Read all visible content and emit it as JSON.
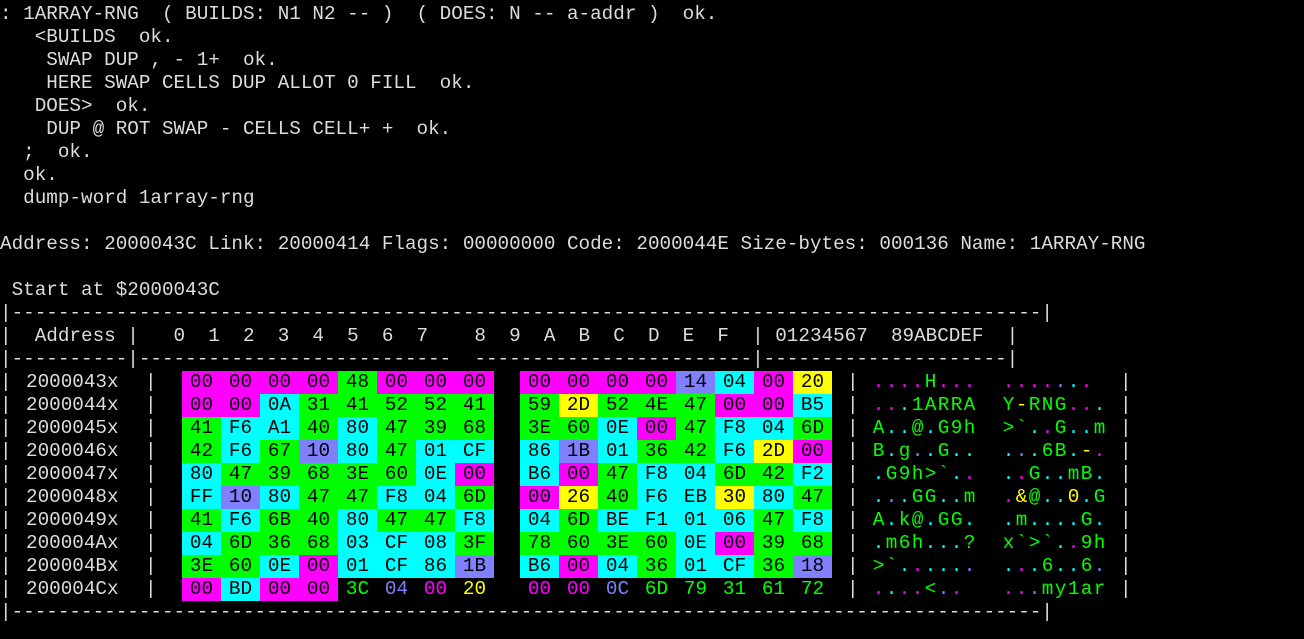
{
  "terminal": {
    "lines": [
      ": 1ARRAY-RNG  ( BUILDS: N1 N2 -- )  ( DOES: N -- a-addr )  ok.",
      "   <BUILDS  ok.",
      "    SWAP DUP , - 1+  ok.",
      "    HERE SWAP CELLS DUP ALLOT 0 FILL  ok.",
      "   DOES>  ok.",
      "    DUP @ ROT SWAP - CELLS CELL+ +  ok.",
      "  ;  ok.",
      "  ok.",
      "  dump-word 1array-rng",
      "",
      "Address: 2000043C Link: 20000414 Flags: 00000000 Code: 2000044E Size-bytes: 000136 Name: 1ARRAY-RNG",
      "",
      " Start at $2000043C",
      "|-----------------------------------------------------------------------------------------|",
      "|  Address |   0  1  2  3  4  5  6  7    8  9  A  B  C  D  E  F  | 01234567  89ABCDEF  |",
      "|----------|---------------------------  ------------------------|---------------------|"
    ],
    "footer_line": "|-----------------------------------------------------------------------------------------|"
  },
  "dump": {
    "colors": {
      "magenta": "#ff00ff",
      "green": "#00ff00",
      "cyan": "#00ffff",
      "periwinkle": "#8080ff",
      "yellow": "#ffff00",
      "black": "#000000"
    },
    "rows": [
      {
        "address": "2000043x",
        "bytes": [
          [
            "00",
            "m"
          ],
          [
            "00",
            "m"
          ],
          [
            "00",
            "m"
          ],
          [
            "00",
            "m"
          ],
          [
            "48",
            "g"
          ],
          [
            "00",
            "m"
          ],
          [
            "00",
            "m"
          ],
          [
            "00",
            "m"
          ],
          [
            "00",
            "m"
          ],
          [
            "00",
            "m"
          ],
          [
            "00",
            "m"
          ],
          [
            "00",
            "m"
          ],
          [
            "14",
            "p"
          ],
          [
            "04",
            "c"
          ],
          [
            "00",
            "m"
          ],
          [
            "20",
            "y"
          ]
        ],
        "ascii_left": "....H...",
        "ascii_right": "......."
      },
      {
        "address": "2000044x",
        "bytes": [
          [
            "00",
            "m"
          ],
          [
            "00",
            "m"
          ],
          [
            "0A",
            "c"
          ],
          [
            "31",
            "g"
          ],
          [
            "41",
            "g"
          ],
          [
            "52",
            "g"
          ],
          [
            "52",
            "g"
          ],
          [
            "41",
            "g"
          ],
          [
            "59",
            "g"
          ],
          [
            "2D",
            "y"
          ],
          [
            "52",
            "g"
          ],
          [
            "4E",
            "g"
          ],
          [
            "47",
            "g"
          ],
          [
            "00",
            "m"
          ],
          [
            "00",
            "m"
          ],
          [
            "B5",
            "c"
          ]
        ],
        "ascii_left": "...1ARRA",
        "ascii_right": "Y-RNG..."
      },
      {
        "address": "2000045x",
        "bytes": [
          [
            "41",
            "g"
          ],
          [
            "F6",
            "c"
          ],
          [
            "A1",
            "c"
          ],
          [
            "40",
            "g"
          ],
          [
            "80",
            "c"
          ],
          [
            "47",
            "g"
          ],
          [
            "39",
            "g"
          ],
          [
            "68",
            "g"
          ],
          [
            "3E",
            "g"
          ],
          [
            "60",
            "g"
          ],
          [
            "0E",
            "c"
          ],
          [
            "00",
            "m"
          ],
          [
            "47",
            "g"
          ],
          [
            "F8",
            "c"
          ],
          [
            "04",
            "c"
          ],
          [
            "6D",
            "g"
          ]
        ],
        "ascii_left": "A..@.G9h",
        "ascii_right": ">`..G..m"
      },
      {
        "address": "2000046x",
        "bytes": [
          [
            "42",
            "g"
          ],
          [
            "F6",
            "c"
          ],
          [
            "67",
            "g"
          ],
          [
            "10",
            "p"
          ],
          [
            "80",
            "c"
          ],
          [
            "47",
            "g"
          ],
          [
            "01",
            "c"
          ],
          [
            "CF",
            "c"
          ],
          [
            "86",
            "c"
          ],
          [
            "1B",
            "p"
          ],
          [
            "01",
            "c"
          ],
          [
            "36",
            "g"
          ],
          [
            "42",
            "g"
          ],
          [
            "F6",
            "c"
          ],
          [
            "2D",
            "y"
          ],
          [
            "00",
            "m"
          ]
        ],
        "ascii_left": "B.g..G..",
        "ascii_right": "...6B.-."
      },
      {
        "address": "2000047x",
        "bytes": [
          [
            "80",
            "c"
          ],
          [
            "47",
            "g"
          ],
          [
            "39",
            "g"
          ],
          [
            "68",
            "g"
          ],
          [
            "3E",
            "g"
          ],
          [
            "60",
            "g"
          ],
          [
            "0E",
            "c"
          ],
          [
            "00",
            "m"
          ],
          [
            "B6",
            "c"
          ],
          [
            "00",
            "m"
          ],
          [
            "47",
            "g"
          ],
          [
            "F8",
            "c"
          ],
          [
            "04",
            "c"
          ],
          [
            "6D",
            "g"
          ],
          [
            "42",
            "g"
          ],
          [
            "F2",
            "c"
          ]
        ],
        "ascii_left": ".G9h>`..",
        "ascii_right": "..G..mB."
      },
      {
        "address": "2000048x",
        "bytes": [
          [
            "FF",
            "c"
          ],
          [
            "10",
            "p"
          ],
          [
            "80",
            "c"
          ],
          [
            "47",
            "g"
          ],
          [
            "47",
            "g"
          ],
          [
            "F8",
            "c"
          ],
          [
            "04",
            "c"
          ],
          [
            "6D",
            "g"
          ],
          [
            "00",
            "m"
          ],
          [
            "26",
            "y"
          ],
          [
            "40",
            "g"
          ],
          [
            "F6",
            "c"
          ],
          [
            "EB",
            "c"
          ],
          [
            "30",
            "y"
          ],
          [
            "80",
            "c"
          ],
          [
            "47",
            "g"
          ]
        ],
        "ascii_left": "...GG..m",
        "ascii_right": ".&@..0.G"
      },
      {
        "address": "2000049x",
        "bytes": [
          [
            "41",
            "g"
          ],
          [
            "F6",
            "c"
          ],
          [
            "6B",
            "g"
          ],
          [
            "40",
            "g"
          ],
          [
            "80",
            "c"
          ],
          [
            "47",
            "g"
          ],
          [
            "47",
            "g"
          ],
          [
            "F8",
            "c"
          ],
          [
            "04",
            "c"
          ],
          [
            "6D",
            "g"
          ],
          [
            "BE",
            "c"
          ],
          [
            "F1",
            "c"
          ],
          [
            "01",
            "c"
          ],
          [
            "06",
            "c"
          ],
          [
            "47",
            "g"
          ],
          [
            "F8",
            "c"
          ]
        ],
        "ascii_left": "A.k@.GG.",
        "ascii_right": ".m....G."
      },
      {
        "address": "200004Ax",
        "bytes": [
          [
            "04",
            "c"
          ],
          [
            "6D",
            "g"
          ],
          [
            "36",
            "g"
          ],
          [
            "68",
            "g"
          ],
          [
            "03",
            "c"
          ],
          [
            "CF",
            "c"
          ],
          [
            "08",
            "c"
          ],
          [
            "3F",
            "g"
          ],
          [
            "78",
            "g"
          ],
          [
            "60",
            "g"
          ],
          [
            "3E",
            "g"
          ],
          [
            "60",
            "g"
          ],
          [
            "0E",
            "c"
          ],
          [
            "00",
            "m"
          ],
          [
            "39",
            "g"
          ],
          [
            "68",
            "g"
          ]
        ],
        "ascii_left": ".m6h...?",
        "ascii_right": "x`>`..9h"
      },
      {
        "address": "200004Bx",
        "bytes": [
          [
            "3E",
            "g"
          ],
          [
            "60",
            "g"
          ],
          [
            "0E",
            "c"
          ],
          [
            "00",
            "m"
          ],
          [
            "01",
            "c"
          ],
          [
            "CF",
            "c"
          ],
          [
            "86",
            "c"
          ],
          [
            "1B",
            "p"
          ],
          [
            "B6",
            "c"
          ],
          [
            "00",
            "m"
          ],
          [
            "04",
            "c"
          ],
          [
            "36",
            "g"
          ],
          [
            "01",
            "c"
          ],
          [
            "CF",
            "c"
          ],
          [
            "36",
            "g"
          ],
          [
            "18",
            "p"
          ]
        ],
        "ascii_left": ">`......",
        "ascii_right": "...6..6."
      },
      {
        "address": "200004Cx",
        "bytes": [
          [
            "00",
            "m"
          ],
          [
            "BD",
            "c"
          ],
          [
            "00",
            "m"
          ],
          [
            "00",
            "m"
          ],
          [
            "3C",
            "G"
          ],
          [
            "04",
            "P"
          ],
          [
            "00",
            "M"
          ],
          [
            "20",
            "Y"
          ],
          [
            "00",
            "M"
          ],
          [
            "00",
            "M"
          ],
          [
            "0C",
            "P"
          ],
          [
            "6D",
            "G"
          ],
          [
            "79",
            "G"
          ],
          [
            "31",
            "G"
          ],
          [
            "61",
            "G"
          ],
          [
            "72",
            "G"
          ]
        ],
        "ascii_left": "....<..",
        "ascii_right": "...my1ar"
      }
    ]
  }
}
